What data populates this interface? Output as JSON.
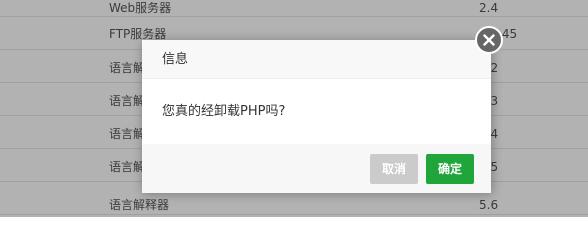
{
  "background_table": {
    "rows": [
      {
        "name": "Web服务器",
        "version": "2.4"
      },
      {
        "name": "FTP服务器",
        "version": "1.0.45"
      },
      {
        "name": "语言解释器",
        "version": "5.2"
      },
      {
        "name": "语言解释器",
        "version": "5.3"
      },
      {
        "name": "语言解释器",
        "version": "5.4"
      },
      {
        "name": "语言解释器",
        "version": "5.5"
      },
      {
        "name": "语言解释器",
        "version": "5.6"
      }
    ]
  },
  "dialog": {
    "title": "信息",
    "message": "您真的经卸载PHP吗?",
    "cancel_label": "取消",
    "ok_label": "确定"
  },
  "colors": {
    "primary": "#20a53a",
    "cancel": "#cbcbcb",
    "close": "#666666"
  }
}
